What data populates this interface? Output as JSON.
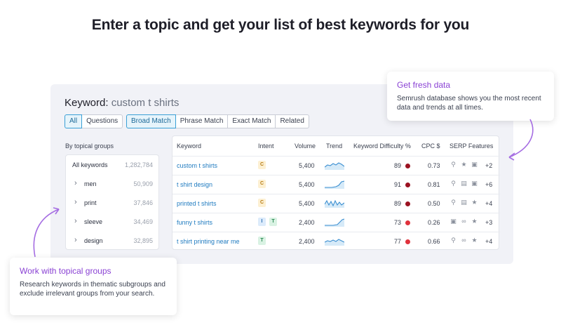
{
  "headline": "Enter a topic and get your list of best keywords for you",
  "keyword_label": "Keyword:",
  "keyword_value": "custom t shirts",
  "tabs_a": [
    "All",
    "Questions"
  ],
  "tabs_b": [
    "Broad Match",
    "Phrase Match",
    "Exact Match",
    "Related"
  ],
  "groups_heading": "By topical groups",
  "groups": [
    {
      "name": "All keywords",
      "count": "1,282,784"
    },
    {
      "name": "men",
      "count": "50,909"
    },
    {
      "name": "print",
      "count": "37,846"
    },
    {
      "name": "sleeve",
      "count": "34,469"
    },
    {
      "name": "design",
      "count": "32,895"
    }
  ],
  "columns": [
    "Keyword",
    "Intent",
    "Volume",
    "Trend",
    "Keyword Difficulty %",
    "CPC $",
    "SERP Features"
  ],
  "rows": [
    {
      "keyword": "custom t shirts",
      "intent": [
        "C"
      ],
      "volume": "5,400",
      "kd": "89",
      "kd_color": "#9b1221",
      "cpc": "0.73",
      "more": "+2",
      "icons": [
        "pin-icon",
        "star-icon",
        "image-icon"
      ]
    },
    {
      "keyword": "t shirt design",
      "intent": [
        "C"
      ],
      "volume": "5,400",
      "kd": "91",
      "kd_color": "#9b1221",
      "cpc": "0.81",
      "more": "+6",
      "icons": [
        "pin-icon",
        "doc-icon",
        "image-icon"
      ]
    },
    {
      "keyword": "printed t shirts",
      "intent": [
        "C"
      ],
      "volume": "5,400",
      "kd": "89",
      "kd_color": "#9b1221",
      "cpc": "0.50",
      "more": "+4",
      "icons": [
        "pin-icon",
        "doc-icon",
        "star-icon"
      ]
    },
    {
      "keyword": "funny t shirts",
      "intent": [
        "I",
        "T"
      ],
      "volume": "2,400",
      "kd": "73",
      "kd_color": "#e0323c",
      "cpc": "0.26",
      "more": "+3",
      "icons": [
        "image-icon",
        "link-icon",
        "star-icon"
      ]
    },
    {
      "keyword": "t shirt printing near me",
      "intent": [
        "T"
      ],
      "volume": "2,400",
      "kd": "77",
      "kd_color": "#e0323c",
      "cpc": "0.66",
      "more": "+4",
      "icons": [
        "pin-icon",
        "link-icon",
        "star-icon"
      ]
    }
  ],
  "tip_right": {
    "title": "Get fresh data",
    "text": "Semrush database shows you the most recent data and trends at all times."
  },
  "tip_left": {
    "title": "Work with topical groups",
    "text": "Research keywords in thematic subgroups and exclude irrelevant groups from your search."
  },
  "colors": {
    "accent": "#8a42d4",
    "link": "#1f7bc0",
    "tab_active": "#3aa0d6"
  }
}
